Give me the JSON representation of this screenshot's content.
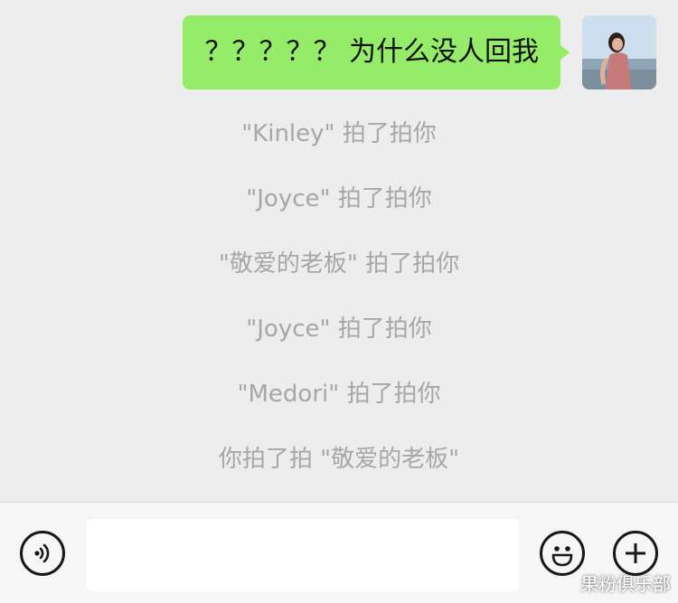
{
  "chat": {
    "outgoing_message": {
      "text": "？？？？？ 为什么没人回我"
    },
    "system_notices": [
      {
        "text": "\"Kinley\" 拍了拍你"
      },
      {
        "text": "\"Joyce\" 拍了拍你"
      },
      {
        "text": "\"敬爱的老板\" 拍了拍你"
      },
      {
        "text": "\"Joyce\" 拍了拍你"
      },
      {
        "text": "\"Medori\" 拍了拍你"
      },
      {
        "text": "你拍了拍 \"敬爱的老板\""
      }
    ]
  },
  "input_bar": {
    "text_value": "",
    "voice_icon": "voice-icon",
    "emoji_icon": "emoji-icon",
    "plus_icon": "plus-icon"
  },
  "watermark": {
    "text": "果粉俱乐部"
  },
  "colors": {
    "chat_background": "#ededed",
    "outgoing_bubble": "#95ec69",
    "notice_text": "#a7a7a7",
    "input_bar_background": "#f6f6f6"
  }
}
